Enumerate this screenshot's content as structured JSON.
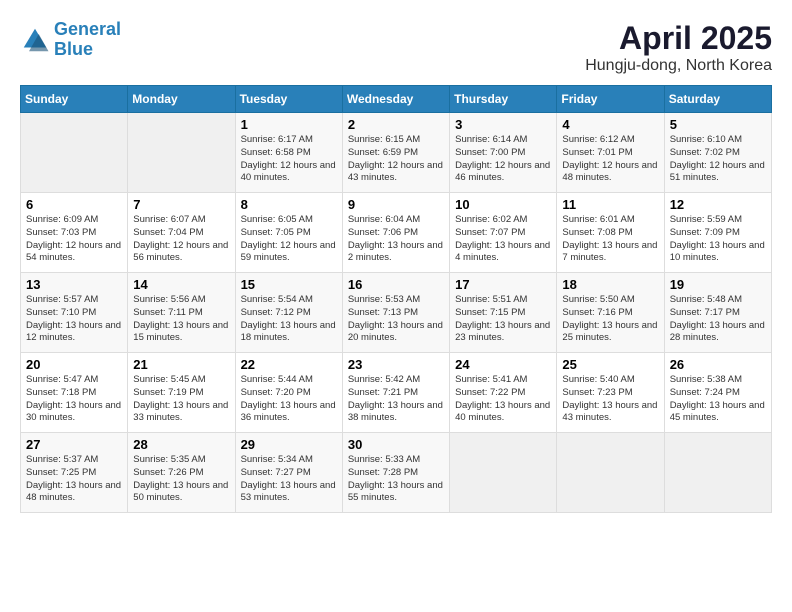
{
  "header": {
    "logo_line1": "General",
    "logo_line2": "Blue",
    "month": "April 2025",
    "location": "Hungju-dong, North Korea"
  },
  "weekdays": [
    "Sunday",
    "Monday",
    "Tuesday",
    "Wednesday",
    "Thursday",
    "Friday",
    "Saturday"
  ],
  "weeks": [
    [
      {
        "day": "",
        "info": ""
      },
      {
        "day": "",
        "info": ""
      },
      {
        "day": "1",
        "info": "Sunrise: 6:17 AM\nSunset: 6:58 PM\nDaylight: 12 hours and 40 minutes."
      },
      {
        "day": "2",
        "info": "Sunrise: 6:15 AM\nSunset: 6:59 PM\nDaylight: 12 hours and 43 minutes."
      },
      {
        "day": "3",
        "info": "Sunrise: 6:14 AM\nSunset: 7:00 PM\nDaylight: 12 hours and 46 minutes."
      },
      {
        "day": "4",
        "info": "Sunrise: 6:12 AM\nSunset: 7:01 PM\nDaylight: 12 hours and 48 minutes."
      },
      {
        "day": "5",
        "info": "Sunrise: 6:10 AM\nSunset: 7:02 PM\nDaylight: 12 hours and 51 minutes."
      }
    ],
    [
      {
        "day": "6",
        "info": "Sunrise: 6:09 AM\nSunset: 7:03 PM\nDaylight: 12 hours and 54 minutes."
      },
      {
        "day": "7",
        "info": "Sunrise: 6:07 AM\nSunset: 7:04 PM\nDaylight: 12 hours and 56 minutes."
      },
      {
        "day": "8",
        "info": "Sunrise: 6:05 AM\nSunset: 7:05 PM\nDaylight: 12 hours and 59 minutes."
      },
      {
        "day": "9",
        "info": "Sunrise: 6:04 AM\nSunset: 7:06 PM\nDaylight: 13 hours and 2 minutes."
      },
      {
        "day": "10",
        "info": "Sunrise: 6:02 AM\nSunset: 7:07 PM\nDaylight: 13 hours and 4 minutes."
      },
      {
        "day": "11",
        "info": "Sunrise: 6:01 AM\nSunset: 7:08 PM\nDaylight: 13 hours and 7 minutes."
      },
      {
        "day": "12",
        "info": "Sunrise: 5:59 AM\nSunset: 7:09 PM\nDaylight: 13 hours and 10 minutes."
      }
    ],
    [
      {
        "day": "13",
        "info": "Sunrise: 5:57 AM\nSunset: 7:10 PM\nDaylight: 13 hours and 12 minutes."
      },
      {
        "day": "14",
        "info": "Sunrise: 5:56 AM\nSunset: 7:11 PM\nDaylight: 13 hours and 15 minutes."
      },
      {
        "day": "15",
        "info": "Sunrise: 5:54 AM\nSunset: 7:12 PM\nDaylight: 13 hours and 18 minutes."
      },
      {
        "day": "16",
        "info": "Sunrise: 5:53 AM\nSunset: 7:13 PM\nDaylight: 13 hours and 20 minutes."
      },
      {
        "day": "17",
        "info": "Sunrise: 5:51 AM\nSunset: 7:15 PM\nDaylight: 13 hours and 23 minutes."
      },
      {
        "day": "18",
        "info": "Sunrise: 5:50 AM\nSunset: 7:16 PM\nDaylight: 13 hours and 25 minutes."
      },
      {
        "day": "19",
        "info": "Sunrise: 5:48 AM\nSunset: 7:17 PM\nDaylight: 13 hours and 28 minutes."
      }
    ],
    [
      {
        "day": "20",
        "info": "Sunrise: 5:47 AM\nSunset: 7:18 PM\nDaylight: 13 hours and 30 minutes."
      },
      {
        "day": "21",
        "info": "Sunrise: 5:45 AM\nSunset: 7:19 PM\nDaylight: 13 hours and 33 minutes."
      },
      {
        "day": "22",
        "info": "Sunrise: 5:44 AM\nSunset: 7:20 PM\nDaylight: 13 hours and 36 minutes."
      },
      {
        "day": "23",
        "info": "Sunrise: 5:42 AM\nSunset: 7:21 PM\nDaylight: 13 hours and 38 minutes."
      },
      {
        "day": "24",
        "info": "Sunrise: 5:41 AM\nSunset: 7:22 PM\nDaylight: 13 hours and 40 minutes."
      },
      {
        "day": "25",
        "info": "Sunrise: 5:40 AM\nSunset: 7:23 PM\nDaylight: 13 hours and 43 minutes."
      },
      {
        "day": "26",
        "info": "Sunrise: 5:38 AM\nSunset: 7:24 PM\nDaylight: 13 hours and 45 minutes."
      }
    ],
    [
      {
        "day": "27",
        "info": "Sunrise: 5:37 AM\nSunset: 7:25 PM\nDaylight: 13 hours and 48 minutes."
      },
      {
        "day": "28",
        "info": "Sunrise: 5:35 AM\nSunset: 7:26 PM\nDaylight: 13 hours and 50 minutes."
      },
      {
        "day": "29",
        "info": "Sunrise: 5:34 AM\nSunset: 7:27 PM\nDaylight: 13 hours and 53 minutes."
      },
      {
        "day": "30",
        "info": "Sunrise: 5:33 AM\nSunset: 7:28 PM\nDaylight: 13 hours and 55 minutes."
      },
      {
        "day": "",
        "info": ""
      },
      {
        "day": "",
        "info": ""
      },
      {
        "day": "",
        "info": ""
      }
    ]
  ]
}
